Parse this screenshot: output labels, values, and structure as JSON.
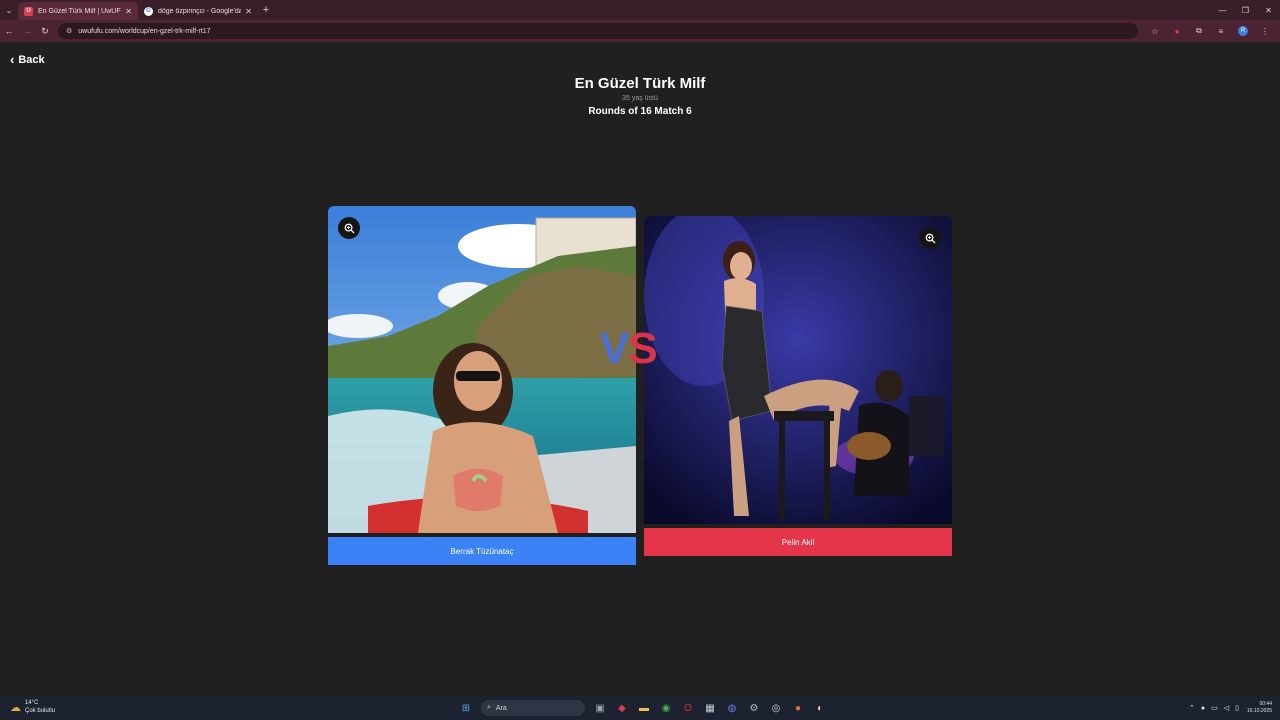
{
  "browser": {
    "tabs": [
      {
        "title": "En Güzel Türk Milf | UwUFUFU",
        "favicon": "U",
        "active": true
      },
      {
        "title": "döge özpirinçci - Google'da Ara",
        "favicon": "G",
        "active": false
      }
    ],
    "new_tab": "+",
    "url": "uwufufu.com/worldcup/en-gzel-trk-milf-rt17"
  },
  "page": {
    "back_label": "Back",
    "title": "En Güzel Türk Milf",
    "subtitle": "35 yaş üstü",
    "round_info": "Rounds of 16 Match 6",
    "vs_label": "VS",
    "left": {
      "name": "Berrak Tüzünataç",
      "button_color": "#3b82f6"
    },
    "right": {
      "name": "Pelin Akil",
      "button_color": "#e5354a"
    }
  },
  "taskbar": {
    "weather_temp": "14°C",
    "weather_desc": "Çok bulutlu",
    "search_placeholder": "Ara",
    "time": "00:44",
    "date": "16.10.2025"
  }
}
